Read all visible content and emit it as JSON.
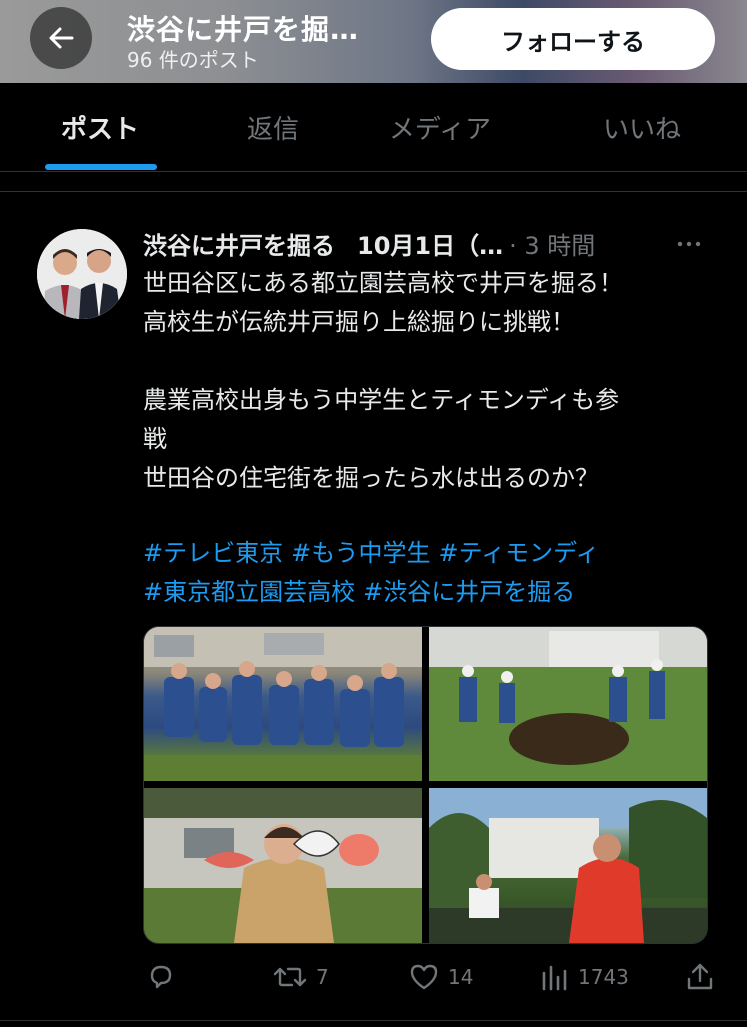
{
  "header": {
    "title": "渋谷に井戸を掘…",
    "post_count": "96 件のポスト",
    "follow_label": "フォローする"
  },
  "tabs": [
    {
      "label": "ポスト",
      "active": true
    },
    {
      "label": "返信",
      "active": false
    },
    {
      "label": "メディア",
      "active": false
    },
    {
      "label": "いいね",
      "active": false
    }
  ],
  "tweet": {
    "author_name": "渋谷に井戸を掘る",
    "date_text": "10月1日（…",
    "time_text": "· 3 時間",
    "lines": [
      "世田谷区にある都立園芸高校で井戸を掘る！",
      "高校生が伝統井戸掘り上総掘りに挑戦！",
      "",
      "農業高校出身もう中学生とティモンディも参",
      "戦",
      "世田谷の住宅街を掘ったら水は出るのか？"
    ],
    "hashtags_line1": [
      "#テレビ東京",
      "#もう中学生",
      "#ティモンディ"
    ],
    "hashtags_line2": [
      "#東京都立園芸高校",
      "#渋谷に井戸を掘る"
    ],
    "media_count": 4,
    "actions": {
      "reply_count": "",
      "retweet_count": "7",
      "like_count": "14",
      "view_count": "1743"
    }
  },
  "colors": {
    "accent": "#1d9bf0",
    "text": "#e7e9ea",
    "muted": "#71767b",
    "background": "#000000"
  },
  "icons": [
    "back-arrow-icon",
    "more-icon",
    "reply-icon",
    "retweet-icon",
    "like-icon",
    "views-icon",
    "share-icon"
  ]
}
